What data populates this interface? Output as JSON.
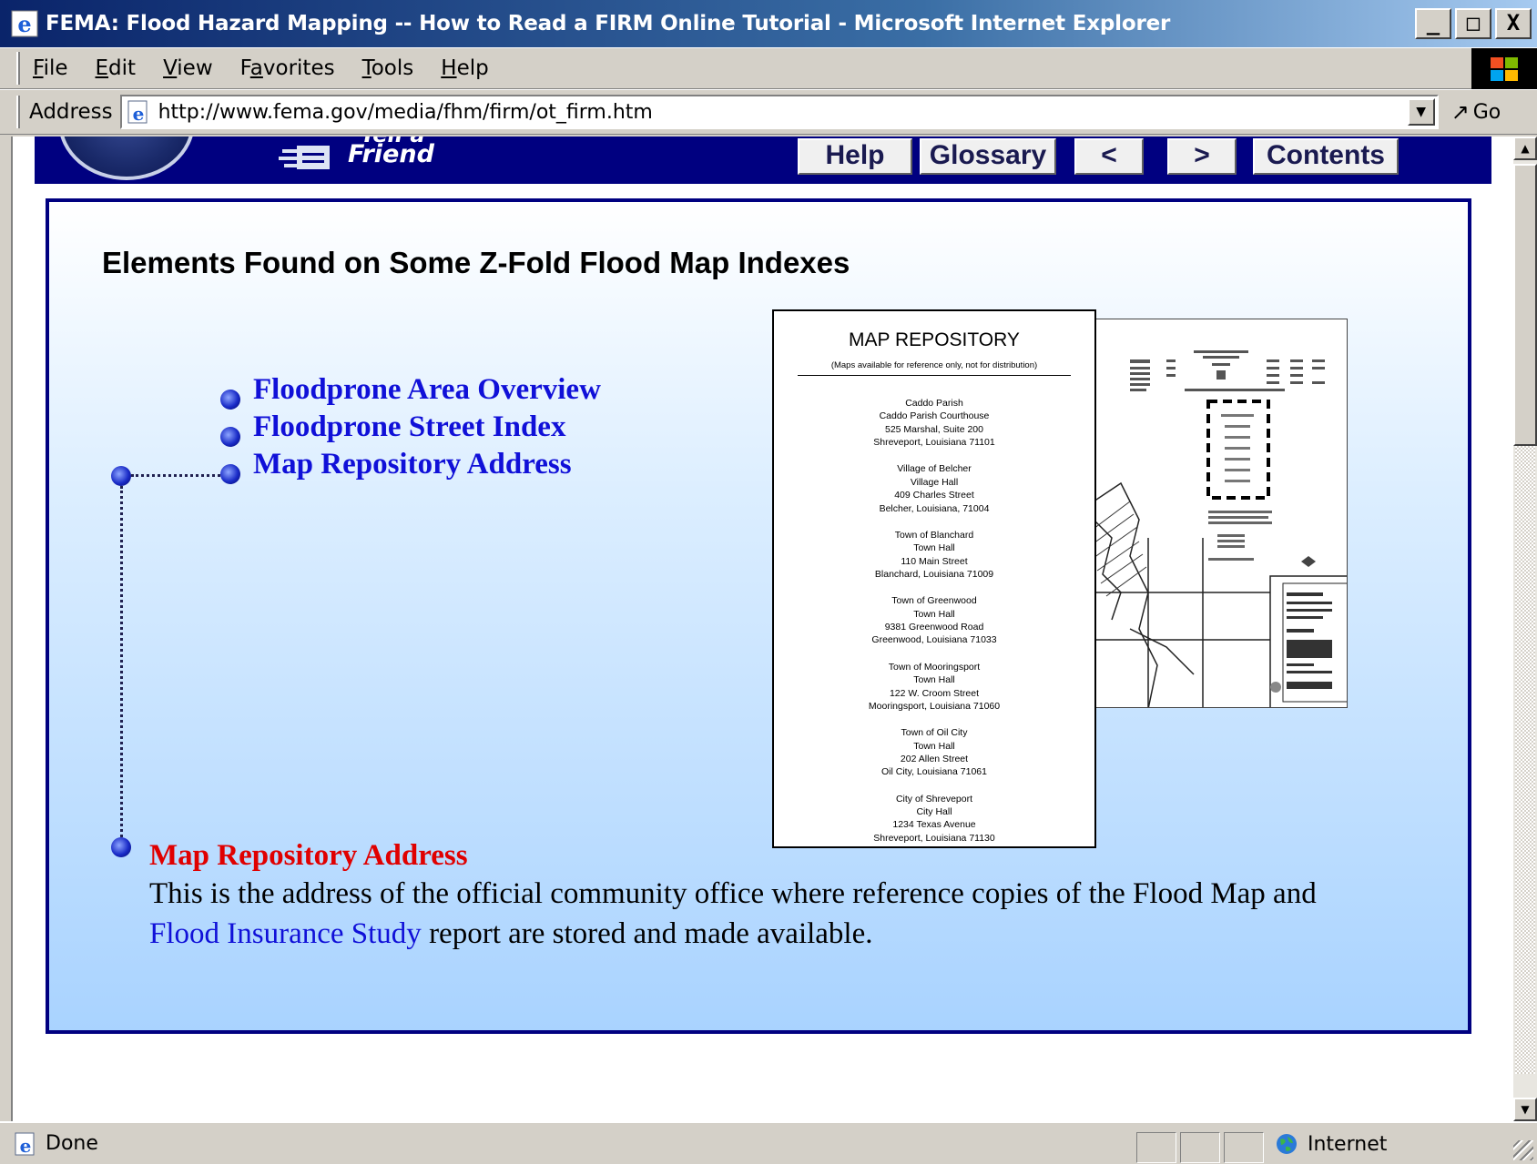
{
  "window": {
    "title": "FEMA: Flood Hazard Mapping -- How to Read a FIRM Online Tutorial - Microsoft Internet Explorer",
    "controls": {
      "minimize": "_",
      "maximize": "□",
      "close": "X"
    }
  },
  "menu": {
    "items": [
      {
        "label": "File",
        "accel": "F"
      },
      {
        "label": "Edit",
        "accel": "E"
      },
      {
        "label": "View",
        "accel": "V"
      },
      {
        "label": "Favorites",
        "accel": "a"
      },
      {
        "label": "Tools",
        "accel": "T"
      },
      {
        "label": "Help",
        "accel": "H"
      }
    ]
  },
  "address": {
    "label": "Address",
    "url": "http://www.fema.gov/media/fhm/firm/ot_firm.htm",
    "go_label": "Go"
  },
  "header": {
    "tell_friend_top": "Tell a",
    "tell_friend": "Friend",
    "nav": {
      "help": "Help",
      "glossary": "Glossary",
      "prev": "<",
      "next": ">",
      "contents": "Contents"
    }
  },
  "panel": {
    "title": "Elements Found on Some Z-Fold Flood Map Indexes",
    "elements": [
      "Floodprone Area Overview",
      "Floodprone Street Index",
      "Map Repository Address"
    ],
    "selected_element": 2
  },
  "repository": {
    "title": "MAP REPOSITORY",
    "subtitle": "(Maps available for reference only, not for distribution)",
    "entries": [
      [
        "Caddo Parish",
        "Caddo Parish Courthouse",
        "525 Marshal, Suite 200",
        "Shreveport, Louisiana 71101"
      ],
      [
        "Village of Belcher",
        "Village Hall",
        "409 Charles Street",
        "Belcher, Louisiana, 71004"
      ],
      [
        "Town of Blanchard",
        "Town Hall",
        "110 Main Street",
        "Blanchard, Louisiana 71009"
      ],
      [
        "Town of Greenwood",
        "Town Hall",
        "9381 Greenwood Road",
        "Greenwood, Louisiana 71033"
      ],
      [
        "Town of Mooringsport",
        "Town Hall",
        "122 W. Croom Street",
        "Mooringsport, Louisiana 71060"
      ],
      [
        "Town of Oil City",
        "Town Hall",
        "202 Allen Street",
        "Oil City, Louisiana 71061"
      ],
      [
        "City of Shreveport",
        "City Hall",
        "1234 Texas Avenue",
        "Shreveport, Louisiana 71130"
      ]
    ]
  },
  "description": {
    "title": "Map Repository Address",
    "text_before_link": "This is the address of the official community office where reference copies of the Flood Map and ",
    "link": "Flood Insurance Study",
    "text_after_link": " report are stored and made available."
  },
  "status": {
    "text": "Done",
    "zone": "Internet"
  },
  "colors": {
    "title_bar": "#0a246a",
    "banner": "#000080",
    "link": "#1010d8",
    "highlight": "#e00000"
  }
}
